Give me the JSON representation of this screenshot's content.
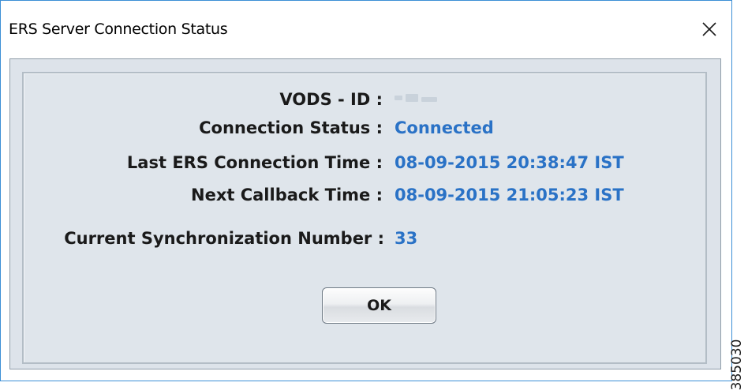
{
  "window": {
    "title": "ERS Server Connection Status",
    "close_icon": "close-icon"
  },
  "status": {
    "vods_id_label": "VODS - ID :",
    "vods_id_value": "",
    "connection_status_label": "Connection Status :",
    "connection_status_value": "Connected",
    "last_connection_label": "Last ERS Connection Time :",
    "last_connection_value": "08-09-2015 20:38:47 IST",
    "next_callback_label": "Next Callback Time :",
    "next_callback_value": "08-09-2015 21:05:23 IST",
    "sync_number_label": "Current Synchronization Number :",
    "sync_number_value": "33"
  },
  "buttons": {
    "ok_label": "OK"
  },
  "figure": {
    "id": "385030"
  },
  "colors": {
    "value_text": "#2a72c6",
    "window_border": "#3c8fd6"
  }
}
